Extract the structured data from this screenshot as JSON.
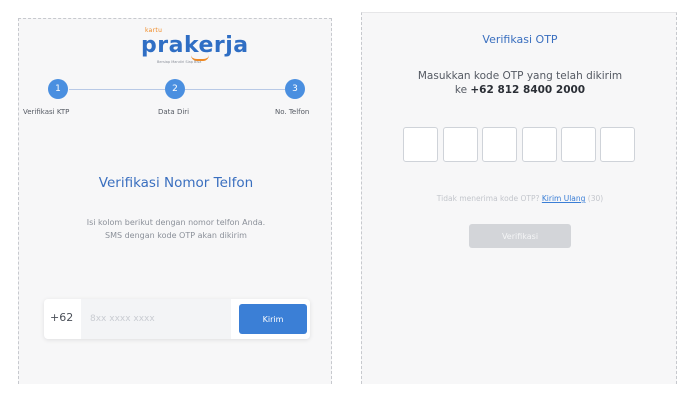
{
  "left": {
    "logo": {
      "small_text": "kartu",
      "main_text": "prakerja",
      "tagline": "Bersiap Mandiri Siap Bisa"
    },
    "steps": [
      {
        "number": "1",
        "label": "Verifikasi KTP"
      },
      {
        "number": "2",
        "label": "Data Diri"
      },
      {
        "number": "3",
        "label": "No. Telfon"
      }
    ],
    "title": "Verifikasi Nomor Telfon",
    "description_line1": "Isi kolom berikut dengan nomor telfon Anda.",
    "description_line2": "SMS dengan kode OTP akan dikirim",
    "phone": {
      "country_code": "+62",
      "placeholder": "8xx xxxx xxxx",
      "value": "",
      "send_label": "Kirim"
    }
  },
  "right": {
    "title": "Verifikasi OTP",
    "description_line1": "Masukkan kode OTP yang telah dikirim",
    "description_prefix": "ke",
    "phone_number": "+62 812 8400 2000",
    "otp_digits": [
      "",
      "",
      "",
      "",
      "",
      ""
    ],
    "resend_text": "Tidak menerima kode OTP?",
    "resend_link": "Kirim Ulang",
    "resend_timer": "(30)",
    "verify_label": "Verifikasi"
  },
  "colors": {
    "accent": "#3b7fd6",
    "step": "#4a8fe0",
    "brand_orange": "#f08a24",
    "disabled": "#d3d5d9"
  }
}
